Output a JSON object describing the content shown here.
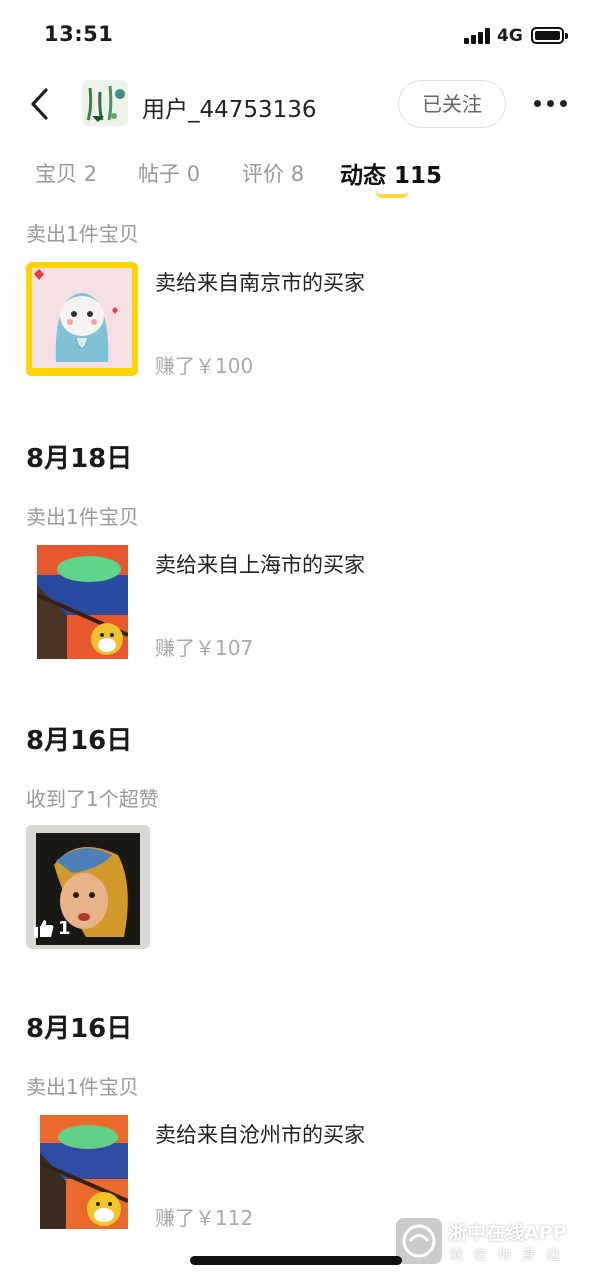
{
  "status_bar": {
    "time": "13:51",
    "network": "4G"
  },
  "header": {
    "username": "用户_44753136",
    "follow_label": "已关注"
  },
  "tabs": [
    {
      "label": "宝贝",
      "count": "2"
    },
    {
      "label": "帖子",
      "count": "0"
    },
    {
      "label": "评价",
      "count": "8"
    },
    {
      "label": "动态",
      "count": "115",
      "active": true
    }
  ],
  "feed": [
    {
      "event": "卖出1件宝贝",
      "text": "卖给来自南京市的买家",
      "earned": "赚了￥100",
      "thumb_icon": "cat-drawing-thumbnail"
    },
    {
      "date": "8月18日",
      "event": "卖出1件宝贝",
      "text": "卖给来自上海市的买家",
      "earned": "赚了￥107",
      "thumb_icon": "scream-painting-thumbnail"
    },
    {
      "date": "8月16日",
      "event": "收到了1个超赞",
      "likes": "1",
      "thumb_icon": "pearl-earring-painting-thumbnail"
    },
    {
      "date": "8月16日",
      "event": "卖出1件宝贝",
      "text": "卖给来自沧州市的买家",
      "earned": "赚了￥112",
      "thumb_icon": "scream-painting-thumbnail"
    }
  ],
  "watermark": {
    "title": "浙中在线APP",
    "subtitle": "就在你身边"
  },
  "colors": {
    "accent": "#ffd740",
    "muted_text": "#999999",
    "thumb_frame": "#ffd400"
  }
}
